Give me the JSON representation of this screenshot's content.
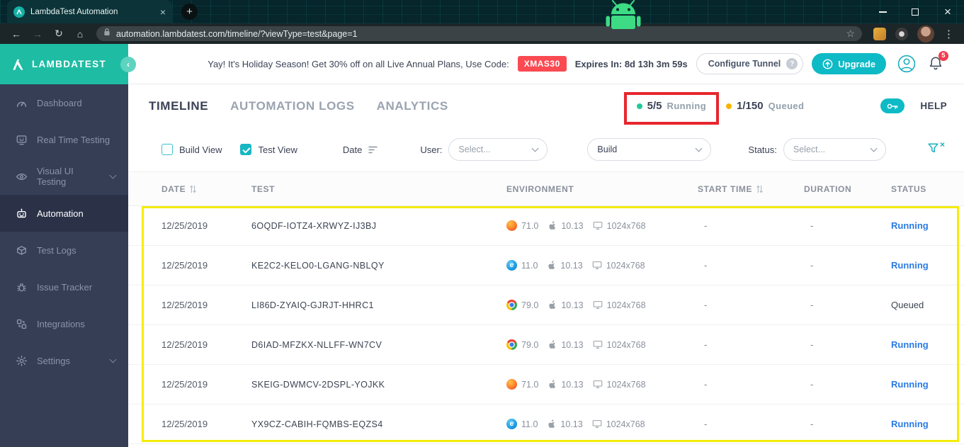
{
  "colors": {
    "brand_teal": "#0EBAC5",
    "logo_teal": "#1FBCA4",
    "sidebar_bg": "#353E54",
    "promo_red": "#FB4A52",
    "running_link_blue": "#2B7BE4",
    "running_dot": "#23C99D",
    "queued_dot": "#F7B500",
    "annotation_red": "#E8262D",
    "annotation_yellow": "#F5EC0A"
  },
  "browser": {
    "tab_title": "LambdaTest Automation",
    "url": "automation.lambdatest.com/timeline/?viewType=test&page=1"
  },
  "sidebar": {
    "brand": "LAMBDATEST",
    "items": [
      {
        "label": "Dashboard",
        "icon": "dashboard",
        "active": false,
        "chevron": false
      },
      {
        "label": "Real Time Testing",
        "icon": "realtime",
        "active": false,
        "chevron": false
      },
      {
        "label": "Visual UI Testing",
        "icon": "visual-ui",
        "active": false,
        "chevron": true
      },
      {
        "label": "Automation",
        "icon": "automation",
        "active": true,
        "chevron": false
      },
      {
        "label": "Test Logs",
        "icon": "test-logs",
        "active": false,
        "chevron": false
      },
      {
        "label": "Issue Tracker",
        "icon": "issue-tracker",
        "active": false,
        "chevron": false
      },
      {
        "label": "Integrations",
        "icon": "integrations",
        "active": false,
        "chevron": false
      },
      {
        "label": "Settings",
        "icon": "settings",
        "active": false,
        "chevron": true
      }
    ]
  },
  "topbar": {
    "promo_prefix": "Yay! It's Holiday Season! Get 30% off on all Live Annual Plans, Use Code:",
    "promo_code": "XMAS30",
    "expires": "Expires In: 8d 13h 3m 59s",
    "configure_tunnel": "Configure Tunnel",
    "tunnel_help": "?",
    "upgrade": "Upgrade",
    "bell_badge": "5"
  },
  "tabs": [
    {
      "label": "TIMELINE",
      "active": true
    },
    {
      "label": "AUTOMATION LOGS",
      "active": false
    },
    {
      "label": "ANALYTICS",
      "active": false
    }
  ],
  "stats": {
    "running_value": "5/5",
    "running_label": "Running",
    "queued_value": "1/150",
    "queued_label": "Queued",
    "help": "HELP"
  },
  "filters": {
    "build_view": "Build View",
    "test_view": "Test View",
    "date": "Date",
    "user_label": "User:",
    "user_value": "Select...",
    "build_value": "Build",
    "status_label": "Status:",
    "status_value": "Select..."
  },
  "table": {
    "headers": [
      "DATE",
      "TEST",
      "ENVIRONMENT",
      "START TIME",
      "DURATION",
      "STATUS"
    ],
    "sortable": [
      "DATE",
      "START TIME"
    ],
    "rows": [
      {
        "date": "12/25/2019",
        "test": "6OQDF-IOTZ4-XRWYZ-IJ3BJ",
        "browser": "firefox",
        "browser_version": "71.0",
        "os": "10.13",
        "resolution": "1024x768",
        "start_time": "-",
        "duration": "-",
        "status": "Running"
      },
      {
        "date": "12/25/2019",
        "test": "KE2C2-KELO0-LGANG-NBLQY",
        "browser": "ie",
        "browser_version": "11.0",
        "os": "10.13",
        "resolution": "1024x768",
        "start_time": "-",
        "duration": "-",
        "status": "Running"
      },
      {
        "date": "12/25/2019",
        "test": "LI86D-ZYAIQ-GJRJT-HHRC1",
        "browser": "chrome",
        "browser_version": "79.0",
        "os": "10.13",
        "resolution": "1024x768",
        "start_time": "-",
        "duration": "-",
        "status": "Queued"
      },
      {
        "date": "12/25/2019",
        "test": "D6IAD-MFZKX-NLLFF-WN7CV",
        "browser": "chrome",
        "browser_version": "79.0",
        "os": "10.13",
        "resolution": "1024x768",
        "start_time": "-",
        "duration": "-",
        "status": "Running"
      },
      {
        "date": "12/25/2019",
        "test": "SKEIG-DWMCV-2DSPL-YOJKK",
        "browser": "firefox",
        "browser_version": "71.0",
        "os": "10.13",
        "resolution": "1024x768",
        "start_time": "-",
        "duration": "-",
        "status": "Running"
      },
      {
        "date": "12/25/2019",
        "test": "YX9CZ-CABIH-FQMBS-EQZS4",
        "browser": "ie",
        "browser_version": "11.0",
        "os": "10.13",
        "resolution": "1024x768",
        "start_time": "-",
        "duration": "-",
        "status": "Running"
      }
    ]
  }
}
